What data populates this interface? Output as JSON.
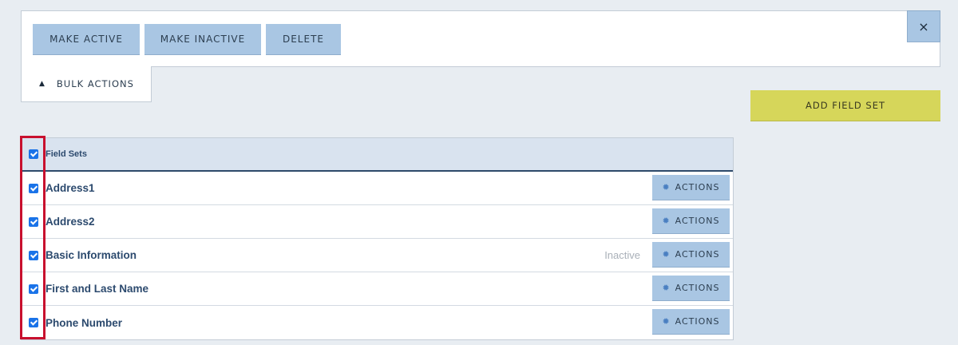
{
  "bulk_actions": {
    "make_active": "MAKE ACTIVE",
    "make_inactive": "MAKE INACTIVE",
    "delete": "DELETE",
    "close": "×",
    "toggle_icon": "▲",
    "toggle_label": "BULK ACTIONS"
  },
  "add_field_set": "ADD FIELD SET",
  "table": {
    "header": "Field Sets",
    "actions_label": "ACTIONS",
    "gear_glyph": "✹",
    "rows": [
      {
        "name": "Address1",
        "status": ""
      },
      {
        "name": "Address2",
        "status": ""
      },
      {
        "name": "Basic Information",
        "status": "Inactive"
      },
      {
        "name": "First and Last Name",
        "status": ""
      },
      {
        "name": "Phone Number",
        "status": ""
      }
    ]
  },
  "colors": {
    "accent_blue": "#a9c6e3",
    "add_button": "#d6d65a",
    "highlight": "#c8102e",
    "checkbox": "#1a73e8"
  }
}
